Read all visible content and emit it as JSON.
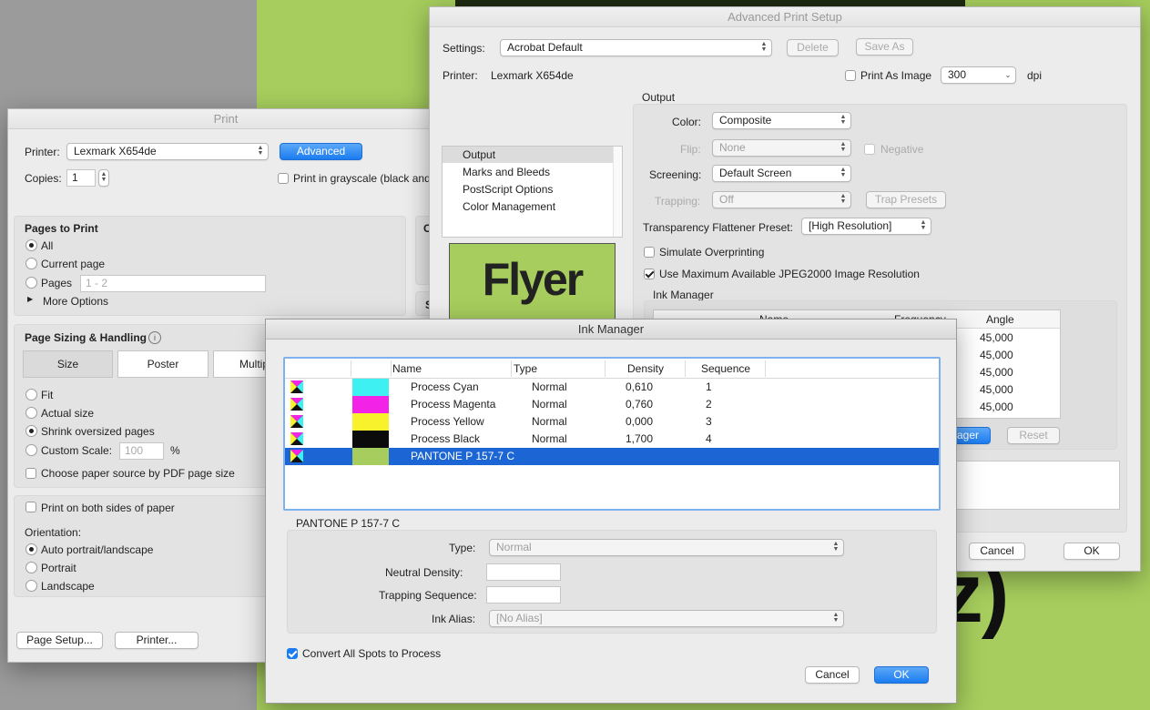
{
  "background": {
    "headline": "Flyer",
    "tail_text": "rz)",
    "color": "#a6cd5d"
  },
  "print": {
    "title": "Print",
    "printer_label": "Printer:",
    "printer_value": "Lexmark X654de",
    "advanced_button": "Advanced",
    "copies_label": "Copies:",
    "copies_value": "1",
    "grayscale_label": "Print in grayscale (black and",
    "right_col_1": "C",
    "right_col_2": "S",
    "pages_title": "Pages to Print",
    "opt_all": "All",
    "opt_current": "Current page",
    "opt_pages": "Pages",
    "pages_placeholder": "1 - 2",
    "more_options": "More Options",
    "sizing_title": "Page Sizing & Handling",
    "tab_size": "Size",
    "tab_poster": "Poster",
    "tab_multiple": "Multip",
    "fit": "Fit",
    "actual": "Actual size",
    "shrink": "Shrink oversized pages",
    "custom": "Custom Scale:",
    "custom_value": "100",
    "percent": "%",
    "paper_source": "Choose paper source by PDF page size",
    "both_sides": "Print on both sides of paper",
    "orientation_label": "Orientation:",
    "auto": "Auto portrait/landscape",
    "portrait": "Portrait",
    "landscape": "Landscape",
    "page_setup": "Page Setup...",
    "printer_button": "Printer..."
  },
  "advanced": {
    "title": "Advanced Print Setup",
    "settings_label": "Settings:",
    "settings_value": "Acrobat Default",
    "delete": "Delete",
    "save_as": "Save As",
    "printer_label": "Printer:",
    "printer_value": "Lexmark X654de",
    "print_as_image": "Print As Image",
    "dpi_value": "300",
    "dpi": "dpi",
    "list": [
      "Output",
      "Marks and Bleeds",
      "PostScript Options",
      "Color Management"
    ],
    "output_title": "Output",
    "color_label": "Color:",
    "color_value": "Composite",
    "flip_label": "Flip:",
    "flip_value": "None",
    "negative": "Negative",
    "screening_label": "Screening:",
    "screening_value": "Default Screen",
    "trapping_label": "Trapping:",
    "trapping_value": "Off",
    "trap_presets": "Trap Presets",
    "flattener_label": "Transparency Flattener Preset:",
    "flattener_value": "[High Resolution]",
    "simulate": "Simulate Overprinting",
    "jpeg2000": "Use Maximum Available JPEG2000 Image Resolution",
    "ink_manager_title": "Ink Manager",
    "ink_cols": [
      "Name",
      "Frequency",
      "Angle"
    ],
    "angles": [
      "45,000",
      "45,000",
      "45,000",
      "45,000",
      "45,000"
    ],
    "ink_manager_button": "ager",
    "reset": "Reset",
    "cancel": "Cancel",
    "ok": "OK"
  },
  "ink": {
    "title": "Ink Manager",
    "columns": {
      "name": "Name",
      "type": "Type",
      "density": "Density",
      "sequence": "Sequence"
    },
    "rows": [
      {
        "name": "Process Cyan",
        "type": "Normal",
        "density": "0,610",
        "sequence": "1",
        "color": "#3ff0f2"
      },
      {
        "name": "Process Magenta",
        "type": "Normal",
        "density": "0,760",
        "sequence": "2",
        "color": "#f222e6"
      },
      {
        "name": "Process Yellow",
        "type": "Normal",
        "density": "0,000",
        "sequence": "3",
        "color": "#f8f22c"
      },
      {
        "name": "Process Black",
        "type": "Normal",
        "density": "1,700",
        "sequence": "4",
        "color": "#0b0b0b"
      },
      {
        "name": "PANTONE P 157-7 C",
        "type": "",
        "density": "",
        "sequence": "",
        "color": "#a6cd5d"
      }
    ],
    "selected_name": "PANTONE P 157-7 C",
    "type_label": "Type:",
    "type_value": "Normal",
    "neutral_label": "Neutral Density:",
    "trapping_label": "Trapping Sequence:",
    "alias_label": "Ink Alias:",
    "alias_value": "[No Alias]",
    "convert_label": "Convert All Spots to Process",
    "cancel": "Cancel",
    "ok": "OK"
  }
}
